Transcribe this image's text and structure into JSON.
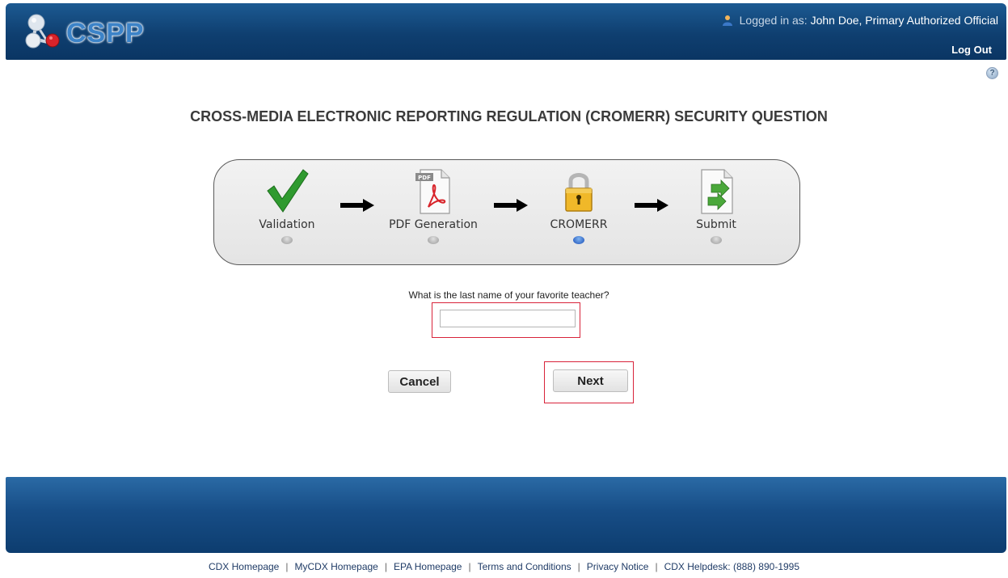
{
  "header": {
    "app_name": "CSPP",
    "logged_in_prefix": "Logged in as:",
    "user_name": "John Doe, Primary Authorized Official",
    "logout_label": "Log Out"
  },
  "help_icon": "help-icon",
  "page_title": "CROSS-MEDIA ELECTRONIC REPORTING REGULATION (CROMERR) SECURITY QUESTION",
  "stepper": {
    "steps": [
      {
        "label": "Validation",
        "icon": "checkmark-icon",
        "active": false
      },
      {
        "label": "PDF Generation",
        "icon": "pdf-icon",
        "active": false
      },
      {
        "label": "CROMERR",
        "icon": "padlock-icon",
        "active": true
      },
      {
        "label": "Submit",
        "icon": "submit-document-icon",
        "active": false
      }
    ],
    "active_color": "#1a4fb8"
  },
  "security_question": {
    "question": "What is the last name of your favorite teacher?",
    "answer_value": "",
    "answer_placeholder": ""
  },
  "buttons": {
    "cancel_label": "Cancel",
    "next_label": "Next"
  },
  "highlight_color": "#d8233a",
  "footer": {
    "links": [
      "CDX Homepage",
      "MyCDX Homepage",
      "EPA Homepage",
      "Terms and Conditions",
      "Privacy Notice",
      "CDX Helpdesk: (888) 890-1995"
    ]
  }
}
